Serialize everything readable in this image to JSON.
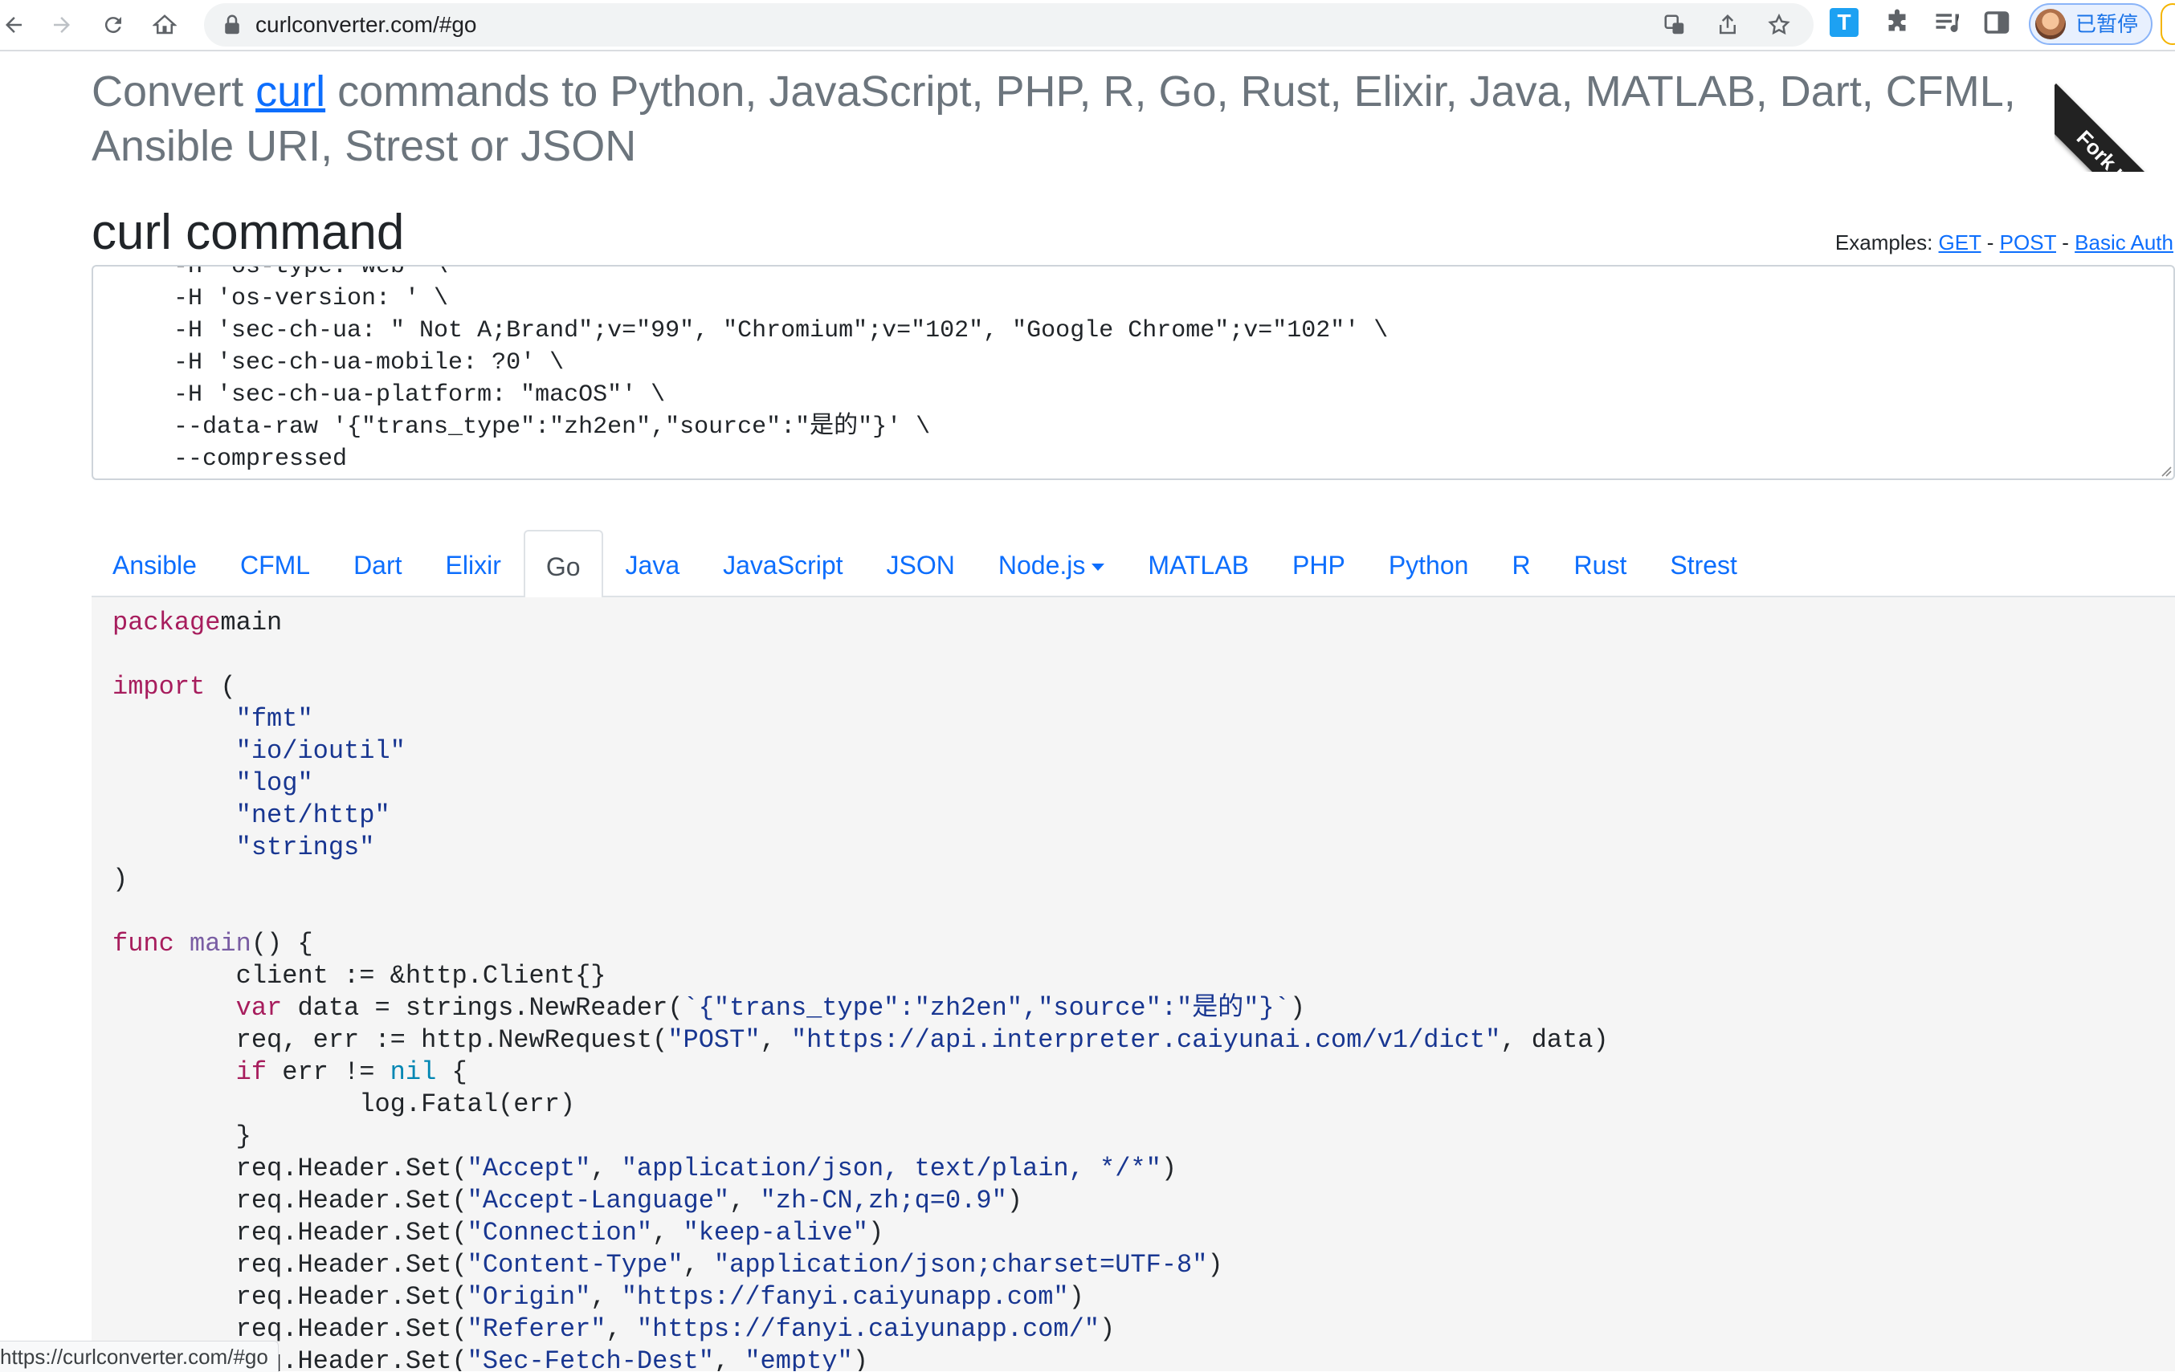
{
  "browser": {
    "url": "curlconverter.com/#go",
    "profile_label": "已暂停",
    "extension_label": "T"
  },
  "page": {
    "headline_prefix": "Convert ",
    "headline_link": "curl",
    "headline_suffix": " commands to Python, JavaScript, PHP, R, Go, Rust, Elixir, Java, MATLAB, Dart, CFML, Ansible URI, Strest or JSON",
    "section_title": "curl command",
    "examples_label": "Examples:",
    "examples": [
      {
        "label": "GET"
      },
      {
        "label": "POST"
      },
      {
        "label": "Basic Auth"
      }
    ],
    "examples_separator": "-",
    "ribbon_text": "Fork m"
  },
  "curl_input": {
    "lines": [
      "  -H 'os-type: web' \\",
      "  -H 'os-version: ' \\",
      "  -H 'sec-ch-ua: \" Not A;Brand\";v=\"99\", \"Chromium\";v=\"102\", \"Google Chrome\";v=\"102\"' \\",
      "  -H 'sec-ch-ua-mobile: ?0' \\",
      "  -H 'sec-ch-ua-platform: \"macOS\"' \\",
      "  --data-raw '{\"trans_type\":\"zh2en\",\"source\":\"是的\"}' \\",
      "  --compressed"
    ]
  },
  "tabs": [
    {
      "label": "Ansible",
      "active": false
    },
    {
      "label": "CFML",
      "active": false
    },
    {
      "label": "Dart",
      "active": false
    },
    {
      "label": "Elixir",
      "active": false
    },
    {
      "label": "Go",
      "active": true
    },
    {
      "label": "Java",
      "active": false
    },
    {
      "label": "JavaScript",
      "active": false
    },
    {
      "label": "JSON",
      "active": false
    },
    {
      "label": "Node.js",
      "active": false,
      "dropdown": true
    },
    {
      "label": "MATLAB",
      "active": false
    },
    {
      "label": "PHP",
      "active": false
    },
    {
      "label": "Python",
      "active": false
    },
    {
      "label": "R",
      "active": false
    },
    {
      "label": "Rust",
      "active": false
    },
    {
      "label": "Strest",
      "active": false
    }
  ],
  "code_output": {
    "language": "go",
    "lines": [
      [
        [
          "kw",
          "package"
        ],
        [
          "",
          "main"
        ]
      ],
      [],
      [
        [
          "kw",
          "import"
        ],
        [
          "",
          " ("
        ]
      ],
      [
        [
          "",
          "\t"
        ],
        [
          "st",
          "\"fmt\""
        ]
      ],
      [
        [
          "",
          "\t"
        ],
        [
          "st",
          "\"io/ioutil\""
        ]
      ],
      [
        [
          "",
          "\t"
        ],
        [
          "st",
          "\"log\""
        ]
      ],
      [
        [
          "",
          "\t"
        ],
        [
          "st",
          "\"net/http\""
        ]
      ],
      [
        [
          "",
          "\t"
        ],
        [
          "st",
          "\"strings\""
        ]
      ],
      [
        [
          "",
          ")"
        ]
      ],
      [],
      [
        [
          "kw",
          "func"
        ],
        [
          "",
          " "
        ],
        [
          "fn",
          "main"
        ],
        [
          "",
          "() {"
        ]
      ],
      [
        [
          "",
          "\tclient := &http.Client{}"
        ]
      ],
      [
        [
          "",
          "\t"
        ],
        [
          "kw",
          "var"
        ],
        [
          "",
          " data = strings.NewReader("
        ],
        [
          "st",
          "`{\"trans_type\":\"zh2en\",\"source\":\"是的\"}`"
        ],
        [
          "",
          ")"
        ]
      ],
      [
        [
          "",
          "\treq, err := http.NewRequest("
        ],
        [
          "st",
          "\"POST\""
        ],
        [
          "",
          ", "
        ],
        [
          "st",
          "\"https://api.interpreter.caiyunai.com/v1/dict\""
        ],
        [
          "",
          ", data)"
        ]
      ],
      [
        [
          "",
          "\t"
        ],
        [
          "kw",
          "if"
        ],
        [
          "",
          " err != "
        ],
        [
          "ct",
          "nil"
        ],
        [
          "",
          " {"
        ]
      ],
      [
        [
          "",
          "\t\tlog.Fatal(err)"
        ]
      ],
      [
        [
          "",
          "\t}"
        ]
      ],
      [
        [
          "",
          "\treq.Header.Set("
        ],
        [
          "st",
          "\"Accept\""
        ],
        [
          "",
          ", "
        ],
        [
          "st",
          "\"application/json, text/plain, */*\""
        ],
        [
          "",
          ")"
        ]
      ],
      [
        [
          "",
          "\treq.Header.Set("
        ],
        [
          "st",
          "\"Accept-Language\""
        ],
        [
          "",
          ", "
        ],
        [
          "st",
          "\"zh-CN,zh;q=0.9\""
        ],
        [
          "",
          ")"
        ]
      ],
      [
        [
          "",
          "\treq.Header.Set("
        ],
        [
          "st",
          "\"Connection\""
        ],
        [
          "",
          ", "
        ],
        [
          "st",
          "\"keep-alive\""
        ],
        [
          "",
          ")"
        ]
      ],
      [
        [
          "",
          "\treq.Header.Set("
        ],
        [
          "st",
          "\"Content-Type\""
        ],
        [
          "",
          ", "
        ],
        [
          "st",
          "\"application/json;charset=UTF-8\""
        ],
        [
          "",
          ")"
        ]
      ],
      [
        [
          "",
          "\treq.Header.Set("
        ],
        [
          "st",
          "\"Origin\""
        ],
        [
          "",
          ", "
        ],
        [
          "st",
          "\"https://fanyi.caiyunapp.com\""
        ],
        [
          "",
          ")"
        ]
      ],
      [
        [
          "",
          "\treq.Header.Set("
        ],
        [
          "st",
          "\"Referer\""
        ],
        [
          "",
          ", "
        ],
        [
          "st",
          "\"https://fanyi.caiyunapp.com/\""
        ],
        [
          "",
          ")"
        ]
      ],
      [
        [
          "",
          "\treq.Header.Set("
        ],
        [
          "st",
          "\"Sec-Fetch-Dest\""
        ],
        [
          "",
          ", "
        ],
        [
          "st",
          "\"empty\""
        ],
        [
          "",
          ")"
        ]
      ]
    ]
  },
  "status_bar": {
    "text": "https://curlconverter.com/#go"
  }
}
